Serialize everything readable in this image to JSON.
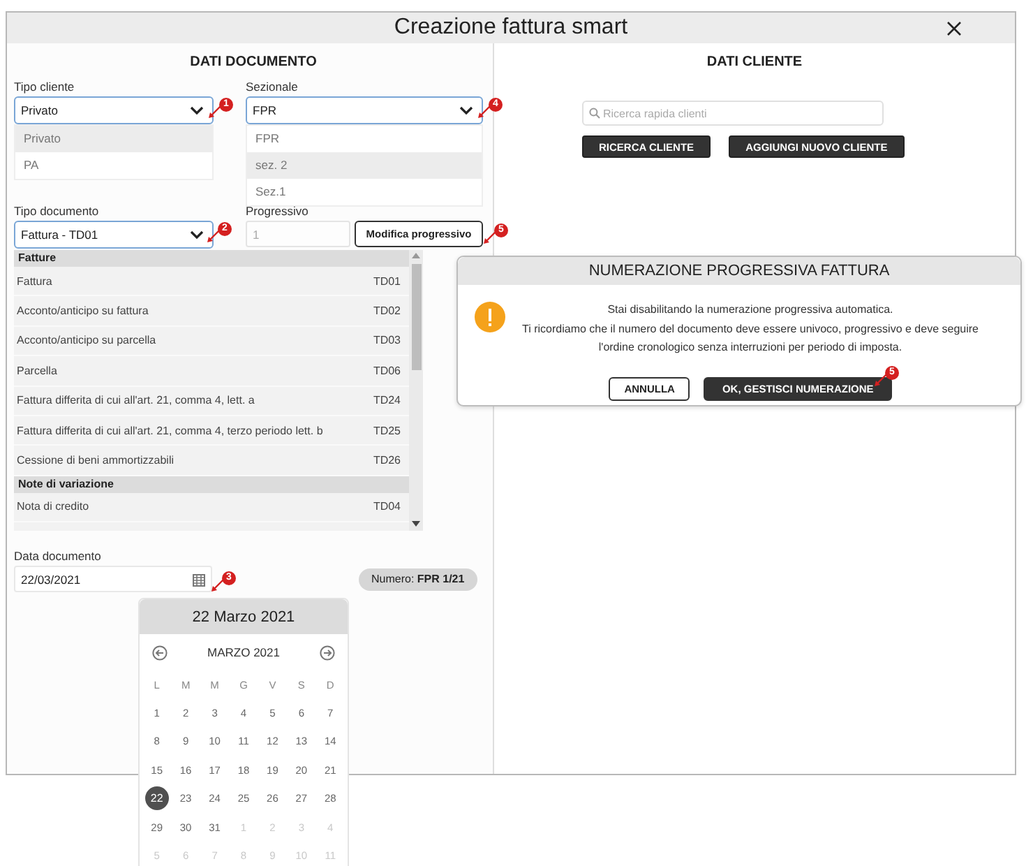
{
  "window": {
    "title": "Creazione fattura smart"
  },
  "document": {
    "heading": "DATI DOCUMENTO",
    "tipo_cliente": {
      "label": "Tipo cliente",
      "value": "Privato",
      "callout": "1",
      "options": [
        {
          "label": "Privato",
          "highlighted": true
        },
        {
          "label": "PA",
          "highlighted": false
        }
      ]
    },
    "sezionale": {
      "label": "Sezionale",
      "value": "FPR",
      "callout": "4",
      "options": [
        {
          "label": "FPR",
          "highlighted": false
        },
        {
          "label": "sez. 2",
          "highlighted": true
        },
        {
          "label": "Sez.1",
          "highlighted": false
        }
      ]
    },
    "tipo_documento": {
      "label": "Tipo documento",
      "value": "Fattura - TD01",
      "callout": "2",
      "groups": [
        {
          "title": "Fatture",
          "items": [
            {
              "name": "Fattura",
              "code": "TD01"
            },
            {
              "name": "Acconto/anticipo su fattura",
              "code": "TD02"
            },
            {
              "name": "Acconto/anticipo su parcella",
              "code": "TD03"
            },
            {
              "name": "Parcella",
              "code": "TD06"
            },
            {
              "name": "Fattura differita di cui all'art. 21, comma 4, lett. a",
              "code": "TD24"
            },
            {
              "name": "Fattura differita di cui all'art. 21, comma 4, terzo periodo lett. b",
              "code": "TD25"
            },
            {
              "name": "Cessione di beni ammortizzabili",
              "code": "TD26"
            }
          ]
        },
        {
          "title": "Note di variazione",
          "items": [
            {
              "name": "Nota di credito",
              "code": "TD04"
            }
          ]
        }
      ]
    },
    "progressivo": {
      "label": "Progressivo",
      "value": "1",
      "disabled": true,
      "button": "Modifica progressivo",
      "callout": "5"
    },
    "data_documento": {
      "label": "Data documento",
      "value": "22/03/2021",
      "callout": "3"
    },
    "numero": "Numero: **FPR 1/21**"
  },
  "client": {
    "heading": "DATI CLIENTE",
    "search": {
      "placeholder": "Ricerca rapida clienti"
    },
    "buttons": [
      "RICERCA CLIENTE",
      "AGGIUNGI NUOVO CLIENTE"
    ]
  },
  "dialog": {
    "title": "NUMERAZIONE PROGRESSIVA FATTURA",
    "message": [
      "Stai disabilitando la numerazione progressiva automatica.",
      "Ti ricordiamo che il numero del documento deve essere univoco, progressivo e deve seguire l'ordine cronologico senza interruzioni per periodo di imposta."
    ],
    "buttons": [
      {
        "label": "ANNULLA",
        "kind": "secondary"
      },
      {
        "label": "OK, GESTISCI NUMERAZIONE",
        "kind": "primary"
      }
    ],
    "callout": "5"
  },
  "calendar": {
    "header": "22 Marzo 2021",
    "month": "MARZO 2021",
    "weekdays": [
      "L",
      "M",
      "M",
      "G",
      "V",
      "S",
      "D"
    ],
    "weeks": [
      [
        {
          "day": "1",
          "muted": false,
          "selected": false
        },
        {
          "day": "2",
          "muted": false,
          "selected": false
        },
        {
          "day": "3",
          "muted": false,
          "selected": false
        },
        {
          "day": "4",
          "muted": false,
          "selected": false
        },
        {
          "day": "5",
          "muted": false,
          "selected": false
        },
        {
          "day": "6",
          "muted": false,
          "selected": false
        },
        {
          "day": "7",
          "muted": false,
          "selected": false
        }
      ],
      [
        {
          "day": "8",
          "muted": false,
          "selected": false
        },
        {
          "day": "9",
          "muted": false,
          "selected": false
        },
        {
          "day": "10",
          "muted": false,
          "selected": false
        },
        {
          "day": "11",
          "muted": false,
          "selected": false
        },
        {
          "day": "12",
          "muted": false,
          "selected": false
        },
        {
          "day": "13",
          "muted": false,
          "selected": false
        },
        {
          "day": "14",
          "muted": false,
          "selected": false
        }
      ],
      [
        {
          "day": "15",
          "muted": false,
          "selected": false
        },
        {
          "day": "16",
          "muted": false,
          "selected": false
        },
        {
          "day": "17",
          "muted": false,
          "selected": false
        },
        {
          "day": "18",
          "muted": false,
          "selected": false
        },
        {
          "day": "19",
          "muted": false,
          "selected": false
        },
        {
          "day": "20",
          "muted": false,
          "selected": false
        },
        {
          "day": "21",
          "muted": false,
          "selected": false
        }
      ],
      [
        {
          "day": "22",
          "muted": false,
          "selected": true
        },
        {
          "day": "23",
          "muted": false,
          "selected": false
        },
        {
          "day": "24",
          "muted": false,
          "selected": false
        },
        {
          "day": "25",
          "muted": false,
          "selected": false
        },
        {
          "day": "26",
          "muted": false,
          "selected": false
        },
        {
          "day": "27",
          "muted": false,
          "selected": false
        },
        {
          "day": "28",
          "muted": false,
          "selected": false
        }
      ],
      [
        {
          "day": "29",
          "muted": false,
          "selected": false
        },
        {
          "day": "30",
          "muted": false,
          "selected": false
        },
        {
          "day": "31",
          "muted": false,
          "selected": false
        },
        {
          "day": "1",
          "muted": true,
          "selected": false
        },
        {
          "day": "2",
          "muted": true,
          "selected": false
        },
        {
          "day": "3",
          "muted": true,
          "selected": false
        },
        {
          "day": "4",
          "muted": true,
          "selected": false
        }
      ],
      [
        {
          "day": "5",
          "muted": true,
          "selected": false
        },
        {
          "day": "6",
          "muted": true,
          "selected": false
        },
        {
          "day": "7",
          "muted": true,
          "selected": false
        },
        {
          "day": "8",
          "muted": true,
          "selected": false
        },
        {
          "day": "9",
          "muted": true,
          "selected": false
        },
        {
          "day": "10",
          "muted": true,
          "selected": false
        },
        {
          "day": "11",
          "muted": true,
          "selected": false
        }
      ]
    ]
  }
}
